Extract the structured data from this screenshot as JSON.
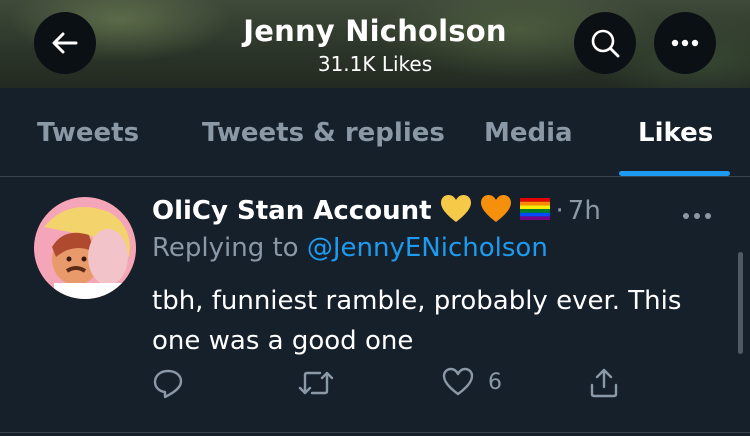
{
  "header": {
    "title": "Jenny Nicholson",
    "subtitle": "31.1K Likes",
    "back_icon": "arrow-left-icon",
    "search_icon": "search-icon",
    "more_icon": "more-horizontal-icon"
  },
  "tabs": [
    {
      "label": "Tweets"
    },
    {
      "label": "Tweets & replies"
    },
    {
      "label": "Media"
    },
    {
      "label": "Likes"
    }
  ],
  "active_tab": "Likes",
  "tweet": {
    "author": "OliCy Stan Account",
    "author_emojis": [
      "yellow-heart",
      "orange-heart",
      "rainbow-flag"
    ],
    "separator": "·",
    "time": "7h",
    "reply_prefix": "Replying to",
    "reply_handle": "@JennyENicholson",
    "text": "tbh, funniest ramble, probably ever. This one was a good one",
    "like_count": "6"
  },
  "colors": {
    "background": "#15202b",
    "accent": "#1d9bf0",
    "muted": "#8b98a5",
    "divider": "#38444d"
  }
}
